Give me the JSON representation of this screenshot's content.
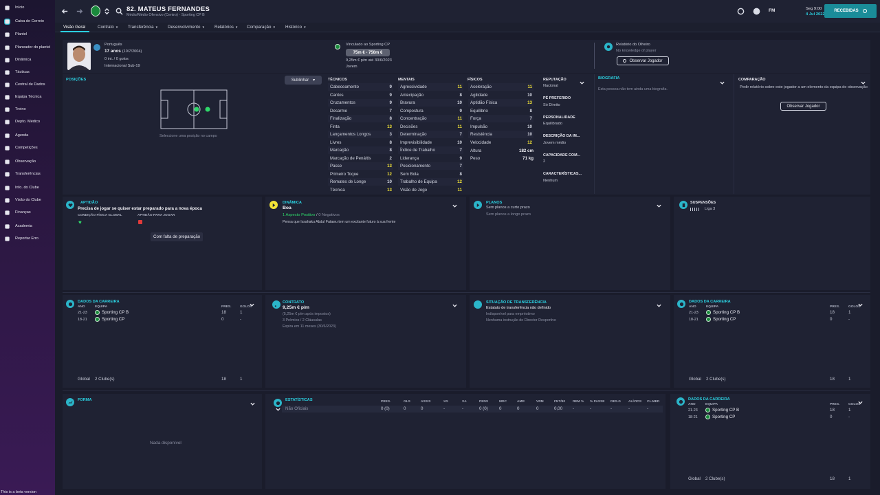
{
  "sidebar": {
    "items": [
      {
        "label": "Início",
        "icon": "home-icon"
      },
      {
        "label": "Caixa de Correio",
        "icon": "mail-icon"
      },
      {
        "label": "Plantel",
        "icon": "shirt-icon"
      },
      {
        "label": "Planeador do plantel",
        "icon": "planner-icon"
      },
      {
        "label": "Dinâmica",
        "icon": "dynamics-icon"
      },
      {
        "label": "Tácticas",
        "icon": "tactics-icon"
      },
      {
        "label": "Central de Dados",
        "icon": "data-icon"
      },
      {
        "label": "Equipa Técnica",
        "icon": "staff-icon"
      },
      {
        "label": "Treino",
        "icon": "training-icon"
      },
      {
        "label": "Depto. Médico",
        "icon": "medical-icon"
      },
      {
        "label": "Agenda",
        "icon": "calendar-icon"
      },
      {
        "label": "Competições",
        "icon": "trophy-icon"
      },
      {
        "label": "Observação",
        "icon": "scout-icon"
      },
      {
        "label": "Transferências",
        "icon": "transfer-icon"
      },
      {
        "label": "Info. do Clube",
        "icon": "club-icon"
      },
      {
        "label": "Visão do Clube",
        "icon": "vision-icon"
      },
      {
        "label": "Finanças",
        "icon": "finance-icon"
      },
      {
        "label": "Academia",
        "icon": "academy-icon"
      },
      {
        "label": "Reportar Erro",
        "icon": "bug-icon"
      }
    ],
    "beta_note": "This is a beta version"
  },
  "topbar": {
    "player_name": "82. MATEUS FERNANDES",
    "player_sub": "Médio/Médio Ofensivo (Centro) - Sporting CP B",
    "fm_label": "FM",
    "date_line1": "Seg 9:00",
    "date_line2": "4 Jul 2022",
    "received_label": "RECEBIDAS"
  },
  "tabs": [
    {
      "label": "Visão Geral"
    },
    {
      "label": "Contrato"
    },
    {
      "label": "Transferência"
    },
    {
      "label": "Desenvolvimento"
    },
    {
      "label": "Relatórios"
    },
    {
      "label": "Comparação"
    },
    {
      "label": "Histórico"
    }
  ],
  "header": {
    "nationality": "Português",
    "age": "17 anos",
    "dob": "(10/7/2004)",
    "caps": "0 int. / 0 golos",
    "youth": "Internacional Sub-19",
    "contract_label": "Vinculado ao Sporting CP",
    "value": "75m € - 750m €",
    "wage": "9,25m € p/m até 30/6/2023",
    "status": "Jovem",
    "scout_title": "Relatório do Olheiro",
    "scout_text": "No knowledge of player",
    "scout_button": "Observar Jogador"
  },
  "positions": {
    "title": "POSIÇÕES",
    "highlight_button": "Sublinhar",
    "hint": "Seleccione uma posição no campo"
  },
  "attributes": {
    "technical_title": "TÉCNICOS",
    "mental_title": "MENTAIS",
    "physical_title": "FÍSICOS",
    "technical": [
      {
        "name": "Cabeceamento",
        "value": "9"
      },
      {
        "name": "Cantos",
        "value": "9"
      },
      {
        "name": "Cruzamentos",
        "value": "9"
      },
      {
        "name": "Desarme",
        "value": "7"
      },
      {
        "name": "Finalização",
        "value": "8"
      },
      {
        "name": "Finta",
        "value": "13",
        "hi": true
      },
      {
        "name": "Lançamentos Longos",
        "value": "3"
      },
      {
        "name": "Livres",
        "value": "8"
      },
      {
        "name": "Marcação",
        "value": "8"
      },
      {
        "name": "Marcação de Penáltis",
        "value": "2"
      },
      {
        "name": "Passe",
        "value": "13",
        "hi": true
      },
      {
        "name": "Primeiro Toque",
        "value": "12",
        "hi": true
      },
      {
        "name": "Remates de Longe",
        "value": "10"
      },
      {
        "name": "Técnica",
        "value": "13",
        "hi": true
      }
    ],
    "mental": [
      {
        "name": "Agressividade",
        "value": "11",
        "hi": true
      },
      {
        "name": "Antecipação",
        "value": "8"
      },
      {
        "name": "Bravura",
        "value": "10"
      },
      {
        "name": "Compostura",
        "value": "9"
      },
      {
        "name": "Concentração",
        "value": "11",
        "hi": true
      },
      {
        "name": "Decisões",
        "value": "11",
        "hi": true
      },
      {
        "name": "Determinação",
        "value": "7"
      },
      {
        "name": "Imprevisibilidade",
        "value": "10"
      },
      {
        "name": "Índice de Trabalho",
        "value": "7"
      },
      {
        "name": "Liderança",
        "value": "9"
      },
      {
        "name": "Posicionamento",
        "value": "7"
      },
      {
        "name": "Sem Bola",
        "value": "8"
      },
      {
        "name": "Trabalho de Equipa",
        "value": "12",
        "hi": true
      },
      {
        "name": "Visão de Jogo",
        "value": "11",
        "hi": true
      }
    ],
    "physical": [
      {
        "name": "Aceleração",
        "value": "11",
        "hi": true
      },
      {
        "name": "Agilidade",
        "value": "10"
      },
      {
        "name": "Aptidão Física",
        "value": "13",
        "hi": true
      },
      {
        "name": "Equilíbrio",
        "value": "8"
      },
      {
        "name": "Força",
        "value": "7"
      },
      {
        "name": "Impulsão",
        "value": "10"
      },
      {
        "name": "Resistência",
        "value": "10"
      },
      {
        "name": "Velocidade",
        "value": "12",
        "hi": true
      }
    ],
    "height_label": "Altura",
    "height_value": "182 cm",
    "weight_label": "Peso",
    "weight_value": "71 kg"
  },
  "info": {
    "reputation_label": "REPUTAÇÃO",
    "reputation_value": "Nacional",
    "foot_label": "PÉ PREFERIDO",
    "foot_value": "Só Direito",
    "personality_label": "PERSONALIDADE",
    "personality_value": "Equilibrado",
    "media_label": "DESCRIÇÃO DA IM...",
    "media_value": "Jovem médio",
    "ability_label": "CAPACIDADE COM...",
    "ability_value": "2",
    "traits_label": "CARACTERÍSTICAS...",
    "traits_value": "Nenhum"
  },
  "biography": {
    "title": "BIOGRAFIA",
    "text": "Esta pessoa não tem ainda uma biografia."
  },
  "comparison": {
    "title": "COMPARAÇÃO",
    "text": "Pedir relatório sobre este jogador a um elemento da equipa de observação",
    "button": "Observar Jogador"
  },
  "fitness": {
    "title": "APTIDÃO",
    "headline": "Precisa de jogar se quiser estar preparado para a nova época",
    "physical_label": "CONDIÇÃO FÍSICA GLOBAL",
    "match_label": "APTIDÃO PARA JOGAR",
    "tooltip": "Com falta de preparação"
  },
  "dynamics": {
    "title": "DINÂMICA",
    "value": "Boa",
    "positive": "1 Aspecto Positivo",
    "sep": "/",
    "negative": "0 Negativos",
    "note": "Pensa que Issahaku Abdul Fatawu tem um excitante futuro à sua frente"
  },
  "plans": {
    "title": "PLANOS",
    "short": "Sem planos a curto prazo",
    "long": "Sem planos a longo prazo"
  },
  "suspensions": {
    "title": "SUSPENSÕES",
    "league": "Liga 3"
  },
  "career": {
    "title": "DADOS DA CARREIRA",
    "col_year": "ANO",
    "col_team": "EQUIPA",
    "col_apps": "PRES.",
    "col_goals": "GOLOS",
    "rows": [
      {
        "year": "21-23",
        "team": "Sporting CP B",
        "apps": "18",
        "goals": "1"
      },
      {
        "year": "18-21",
        "team": "Sporting CP",
        "apps": "0",
        "goals": "-"
      }
    ],
    "total_label": "Global",
    "total_clubs": "2 Clube(s)",
    "total_apps": "18",
    "total_goals": "1"
  },
  "contract": {
    "title": "CONTRATO",
    "wage": "9,25m € p/m",
    "after_tax": "(5,25m € p/m após impostos)",
    "bonuses": "3 Prémios / 2 Cláusulas",
    "expires": "Expira em 11 meses (30/6/2023)"
  },
  "transfer": {
    "title": "SITUAÇÃO DE TRANSFERÊNCIA",
    "status": "Estatuto de transferência não definido",
    "loan": "Indisponível para empréstimo",
    "director": "Nenhuma instrução do Director Desportivo"
  },
  "form": {
    "title": "FORMA",
    "empty": "Nada disponível"
  },
  "stats": {
    "title": "ESTATÍSTICAS",
    "columns": [
      "PRES.",
      "GLS",
      "ASSIS",
      "XG",
      "XA",
      "PENS",
      "MDC",
      "AMR",
      "VRM",
      "FNT/90",
      "REM %",
      "% PASSE",
      "DES.G",
      "ALÍVIOS",
      "CL.MED"
    ],
    "row_label": "Não Oficiais",
    "row_values": [
      "0 (0)",
      "0",
      "0",
      "-",
      "-",
      "0 (0)",
      "0",
      "0",
      "0",
      "0,00",
      "-",
      "-",
      "-",
      "-",
      "-"
    ]
  }
}
